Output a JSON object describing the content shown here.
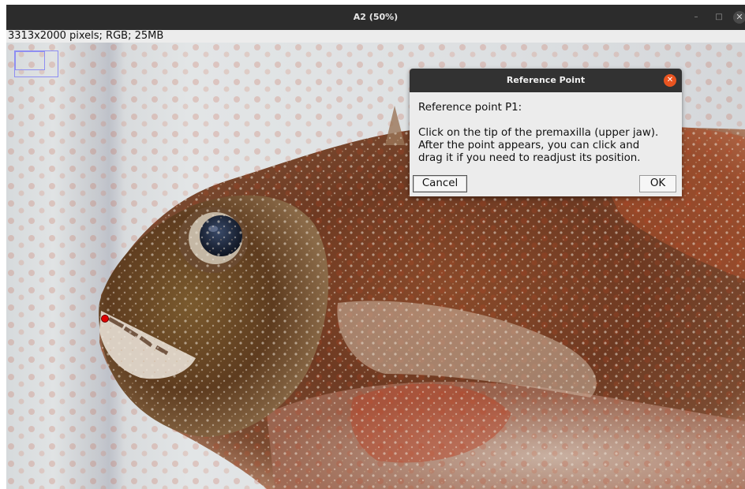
{
  "window": {
    "title": "A2 (50%)",
    "controls": {
      "minimize": "–",
      "maximize": "□",
      "close": "✕"
    }
  },
  "image_info": "3313x2000 pixels; RGB; 25MB",
  "dialog": {
    "title": "Reference Point",
    "close_icon": "✕",
    "heading": "Reference point P1:",
    "lines": [
      "Click on the tip of the premaxilla (upper jaw).",
      "After the point appears, you can click and",
      "drag it if you need to readjust its position."
    ],
    "cancel_label": "Cancel",
    "ok_label": "OK"
  },
  "colors": {
    "titlebar": "#2c2c2c",
    "dialog_close": "#e95420",
    "marker": "#e00000",
    "navigator": "#8e8ef2"
  }
}
